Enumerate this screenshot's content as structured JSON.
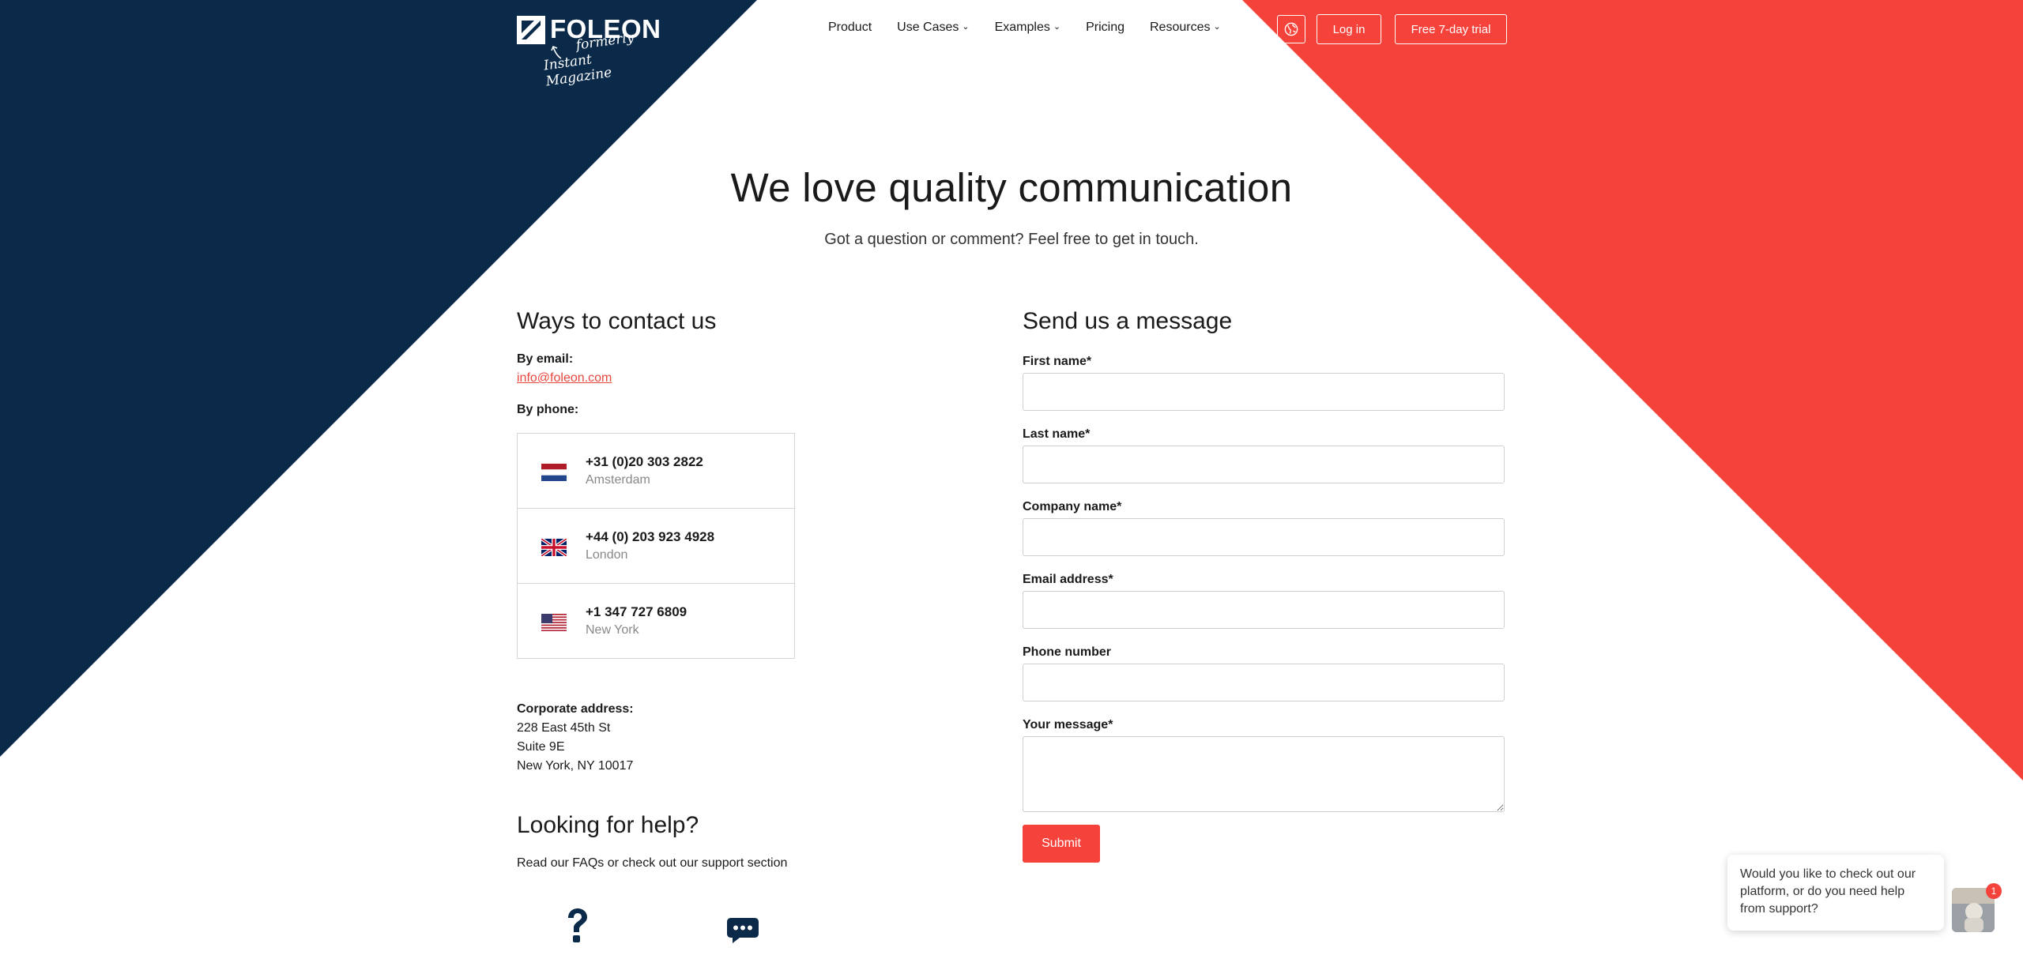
{
  "brand": {
    "name": "FOLEON",
    "tagline_line1": "formerly",
    "tagline_line2": "Instant Magazine",
    "colors": {
      "navy": "#0b2a4a",
      "red": "#f5423a"
    }
  },
  "nav": {
    "items": [
      {
        "label": "Product",
        "has_dropdown": false
      },
      {
        "label": "Use Cases",
        "has_dropdown": true
      },
      {
        "label": "Examples",
        "has_dropdown": true
      },
      {
        "label": "Pricing",
        "has_dropdown": false
      },
      {
        "label": "Resources",
        "has_dropdown": true
      }
    ],
    "chevron": "⌄",
    "globe_icon": "globe-icon",
    "login_label": "Log in",
    "trial_label": "Free 7-day trial"
  },
  "hero": {
    "title": "We love quality communication",
    "subtitle": "Got a question or comment? Feel free to get in touch."
  },
  "contact": {
    "title": "Ways to contact us",
    "email_label": "By email:",
    "email": "info@foleon.com",
    "phone_label": "By phone:",
    "phones": [
      {
        "number": "+31 (0)20 303 2822",
        "city": "Amsterdam",
        "flag": "netherlands-flag"
      },
      {
        "number": "+44 (0) 203 923 4928",
        "city": "London",
        "flag": "uk-flag"
      },
      {
        "number": "+1 347 727 6809",
        "city": "New York",
        "flag": "us-flag"
      }
    ],
    "address_label": "Corporate address:",
    "address_lines": [
      "228 East 45th St",
      "Suite 9E",
      "New York, NY 10017"
    ]
  },
  "help": {
    "title": "Looking for help?",
    "text": "Read our FAQs or check out our support section"
  },
  "form": {
    "title": "Send us a message",
    "fields": [
      {
        "label": "First name*",
        "value": ""
      },
      {
        "label": "Last name*",
        "value": ""
      },
      {
        "label": "Company name*",
        "value": ""
      },
      {
        "label": "Email address*",
        "value": ""
      },
      {
        "label": "Phone number",
        "value": ""
      },
      {
        "label": "Your message*",
        "value": ""
      }
    ],
    "submit_label": "Submit"
  },
  "chat": {
    "message": "Would you like to check out our platform, or do you need help from support?",
    "badge_count": "1"
  }
}
